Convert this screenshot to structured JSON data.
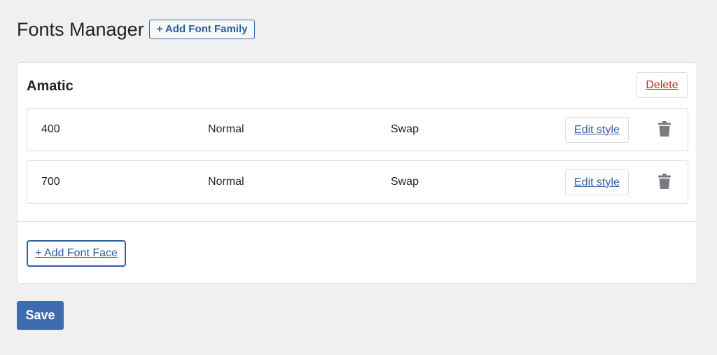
{
  "header": {
    "title": "Fonts Manager",
    "add_family_label": "+ Add Font Family"
  },
  "family": {
    "name": "Amatic",
    "delete_label": "Delete",
    "faces": [
      {
        "weight": "400",
        "style": "Normal",
        "display": "Swap",
        "edit_label": "Edit style",
        "delete_icon": "trash-icon"
      },
      {
        "weight": "700",
        "style": "Normal",
        "display": "Swap",
        "edit_label": "Edit style",
        "delete_icon": "trash-icon"
      }
    ],
    "add_face_label": "+ Add Font Face"
  },
  "footer": {
    "save_label": "Save"
  },
  "colors": {
    "accent": "#2f5f9f",
    "primary_button": "#3e6ab0",
    "danger": "#b32d2e",
    "icon": "#787c82",
    "background": "#f0f0f1"
  }
}
